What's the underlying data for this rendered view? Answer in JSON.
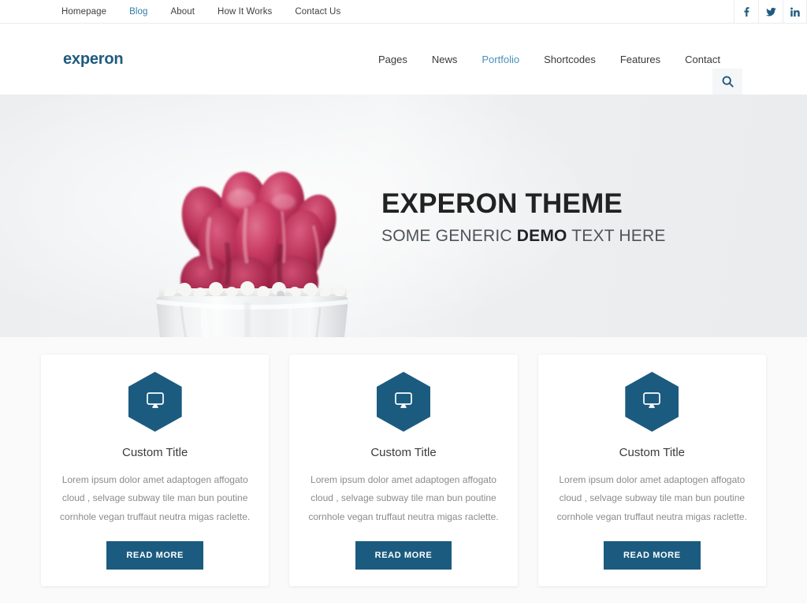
{
  "topbar": {
    "links": [
      {
        "label": "Homepage",
        "active": false
      },
      {
        "label": "Blog",
        "active": true
      },
      {
        "label": "About",
        "active": false
      },
      {
        "label": "How It Works",
        "active": false
      },
      {
        "label": "Contact Us",
        "active": false
      }
    ],
    "social": [
      {
        "name": "facebook-icon",
        "label": "f"
      },
      {
        "name": "twitter-icon",
        "label": "t"
      },
      {
        "name": "linkedin-icon",
        "label": "in"
      }
    ]
  },
  "header": {
    "logo": "experon",
    "nav": [
      {
        "label": "Pages",
        "active": false
      },
      {
        "label": "News",
        "active": false
      },
      {
        "label": "Portfolio",
        "active": true
      },
      {
        "label": "Shortcodes",
        "active": false
      },
      {
        "label": "Features",
        "active": false
      },
      {
        "label": "Contact",
        "active": false
      }
    ],
    "search_icon": "search-icon"
  },
  "hero": {
    "title": "EXPERON THEME",
    "subtitle_pre": "SOME GENERIC ",
    "subtitle_bold": "DEMO",
    "subtitle_post": " TEXT HERE",
    "image_alt": "pink cactus in white ceramic pot"
  },
  "cards": [
    {
      "icon": "monitor-icon",
      "title": "Custom Title",
      "text": "Lorem ipsum dolor amet adaptogen affogato cloud , selvage subway tile man bun poutine cornhole vegan truffaut neutra migas raclette.",
      "button": "READ MORE"
    },
    {
      "icon": "monitor-icon",
      "title": "Custom Title",
      "text": "Lorem ipsum dolor amet adaptogen affogato cloud , selvage subway tile man bun poutine cornhole vegan truffaut neutra migas raclette.",
      "button": "READ MORE"
    },
    {
      "icon": "monitor-icon",
      "title": "Custom Title",
      "text": "Lorem ipsum dolor amet adaptogen affogato cloud , selvage subway tile man bun poutine cornhole vegan truffaut neutra migas raclette.",
      "button": "READ MORE"
    }
  ],
  "colors": {
    "brand": "#1b5b7f",
    "accent_link": "#2f7ca8",
    "hero_bg": "#eceef0",
    "section_bg": "#fafafa",
    "cactus": "#c2295a"
  }
}
